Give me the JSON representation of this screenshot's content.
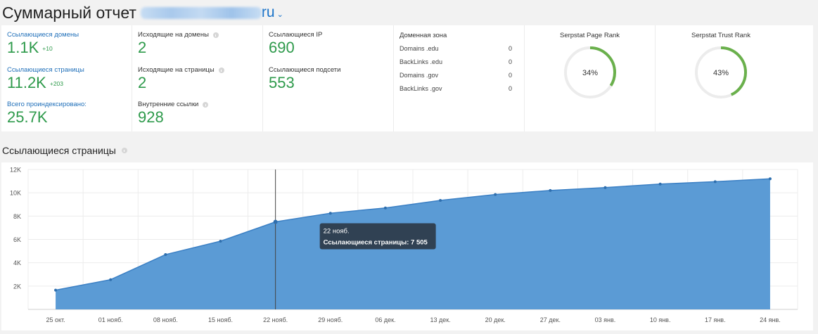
{
  "header": {
    "title": "Суммарный отчет",
    "domain_tld": "ru"
  },
  "cards": {
    "referring": {
      "domains_label": "Ссылающиеся домены",
      "domains_value": "1.1K",
      "domains_delta": "+10",
      "pages_label": "Ссылающиеся страницы",
      "pages_value": "11.2K",
      "pages_delta": "+203",
      "indexed_label": "Всего проиндексировано:",
      "indexed_value": "25.7K"
    },
    "outgoing": {
      "domains_label": "Исходящие на домены",
      "domains_value": "2",
      "pages_label": "Исходящие на страницы",
      "pages_value": "2",
      "internal_label": "Внутренние ссылки",
      "internal_value": "928"
    },
    "ips": {
      "ip_label": "Ссылающиеся IP",
      "ip_value": "690",
      "subnets_label": "Ссылающиеся подсети",
      "subnets_value": "553"
    },
    "zone": {
      "title": "Доменная зона",
      "rows": [
        {
          "label": "Domains .edu",
          "value": "0"
        },
        {
          "label": "BackLinks .edu",
          "value": "0"
        },
        {
          "label": "Domains .gov",
          "value": "0"
        },
        {
          "label": "BackLinks .gov",
          "value": "0"
        }
      ]
    },
    "page_rank": {
      "title": "Serpstat Page Rank",
      "value": 34,
      "label": "34%"
    },
    "trust_rank": {
      "title": "Serpstat Trust Rank",
      "value": 43,
      "label": "43%"
    }
  },
  "colors": {
    "accent_green": "#2e9a4b",
    "gauge_green": "#6ab04c",
    "gauge_track": "#ececec",
    "chart_fill": "#5b9bd5",
    "chart_line": "#3a7fc4",
    "link_blue": "#1f6fb9"
  },
  "chart_section": {
    "title": "Ссылающиеся страницы"
  },
  "chart_data": {
    "type": "area",
    "title": "",
    "xlabel": "",
    "ylabel": "",
    "categories": [
      "25 окт.",
      "01 нояб.",
      "08 нояб.",
      "15 нояб.",
      "22 нояб.",
      "29 нояб.",
      "06 дек.",
      "13 дек.",
      "20 дек.",
      "27 дек.",
      "03 янв.",
      "10 янв.",
      "17 янв.",
      "24 янв."
    ],
    "series": [
      {
        "name": "Ссылающиеся страницы",
        "values": [
          1650,
          2550,
          4700,
          5850,
          7505,
          8250,
          8700,
          9350,
          9850,
          10200,
          10450,
          10750,
          10950,
          11200
        ]
      }
    ],
    "ylim": [
      0,
      12000
    ],
    "yticks": [
      {
        "value": 2000,
        "label": "2K"
      },
      {
        "value": 4000,
        "label": "4K"
      },
      {
        "value": 6000,
        "label": "6K"
      },
      {
        "value": 8000,
        "label": "8K"
      },
      {
        "value": 10000,
        "label": "10K"
      },
      {
        "value": 12000,
        "label": "12K"
      }
    ],
    "grid": true,
    "tooltip": {
      "index": 4,
      "date": "22 нояб.",
      "text": "Ссылающиеся страницы: 7 505"
    }
  }
}
